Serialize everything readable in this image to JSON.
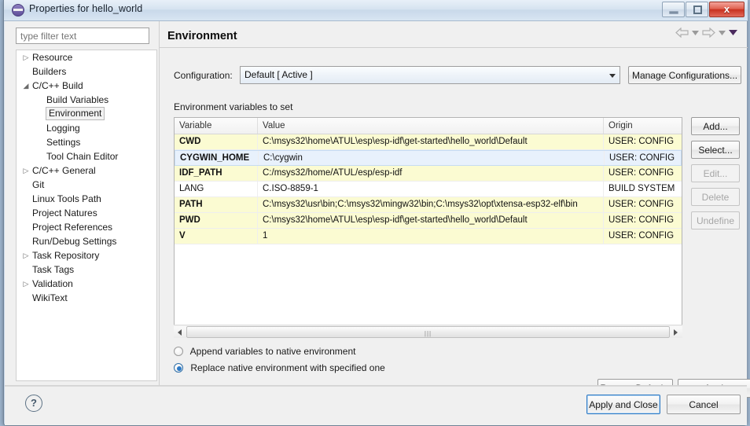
{
  "window": {
    "title": "Properties for hello_world",
    "icon": "eclipse-icon",
    "minimize_label": "",
    "restore_label": "",
    "close_label": "x"
  },
  "sidebar": {
    "filter_placeholder": "type filter text",
    "filter_value": "",
    "items": [
      {
        "label": "Resource",
        "indent": 0,
        "twisty": "collapsed",
        "selected": false
      },
      {
        "label": "Builders",
        "indent": 0,
        "twisty": "none",
        "selected": false
      },
      {
        "label": "C/C++ Build",
        "indent": 0,
        "twisty": "expanded",
        "selected": false
      },
      {
        "label": "Build Variables",
        "indent": 1,
        "twisty": "none",
        "selected": false
      },
      {
        "label": "Environment",
        "indent": 1,
        "twisty": "none",
        "selected": true
      },
      {
        "label": "Logging",
        "indent": 1,
        "twisty": "none",
        "selected": false
      },
      {
        "label": "Settings",
        "indent": 1,
        "twisty": "none",
        "selected": false
      },
      {
        "label": "Tool Chain Editor",
        "indent": 1,
        "twisty": "none",
        "selected": false
      },
      {
        "label": "C/C++ General",
        "indent": 0,
        "twisty": "collapsed",
        "selected": false
      },
      {
        "label": "Git",
        "indent": 0,
        "twisty": "none",
        "selected": false
      },
      {
        "label": "Linux Tools Path",
        "indent": 0,
        "twisty": "none",
        "selected": false
      },
      {
        "label": "Project Natures",
        "indent": 0,
        "twisty": "none",
        "selected": false
      },
      {
        "label": "Project References",
        "indent": 0,
        "twisty": "none",
        "selected": false
      },
      {
        "label": "Run/Debug Settings",
        "indent": 0,
        "twisty": "none",
        "selected": false
      },
      {
        "label": "Task Repository",
        "indent": 0,
        "twisty": "collapsed",
        "selected": false
      },
      {
        "label": "Task Tags",
        "indent": 0,
        "twisty": "none",
        "selected": false
      },
      {
        "label": "Validation",
        "indent": 0,
        "twisty": "collapsed",
        "selected": false
      },
      {
        "label": "WikiText",
        "indent": 0,
        "twisty": "none",
        "selected": false
      }
    ]
  },
  "page": {
    "title": "Environment",
    "nav": {
      "back_icon": "back-arrow-icon",
      "back_menu_icon": "chevron-down-icon",
      "forward_icon": "forward-arrow-icon",
      "forward_menu_icon": "chevron-down-icon",
      "view_menu_icon": "view-menu-triangle-icon"
    },
    "configuration": {
      "label": "Configuration:",
      "selected": "Default  [ Active ]",
      "dropdown_icon": "chevron-down-icon",
      "manage_label": "Manage Configurations..."
    },
    "table_label": "Environment variables to set",
    "table": {
      "columns": [
        "Variable",
        "Value",
        "Origin"
      ],
      "rows": [
        {
          "variable": "CWD",
          "value": "C:\\msys32\\home\\ATUL\\esp\\esp-idf\\get-started\\hello_world\\Default",
          "origin": "USER: CONFIG",
          "user_set": true,
          "selected": false
        },
        {
          "variable": "CYGWIN_HOME",
          "value": "C:\\cygwin",
          "origin": "USER: CONFIG",
          "user_set": true,
          "selected": true
        },
        {
          "variable": "IDF_PATH",
          "value": "C:/msys32/home/ATUL/esp/esp-idf",
          "origin": "USER: CONFIG",
          "user_set": true,
          "selected": false
        },
        {
          "variable": "LANG",
          "value": "C.ISO-8859-1",
          "origin": "BUILD SYSTEM",
          "user_set": false,
          "selected": false
        },
        {
          "variable": "PATH",
          "value": "C:\\msys32\\usr\\bin;C:\\msys32\\mingw32\\bin;C:\\msys32\\opt\\xtensa-esp32-elf\\bin",
          "origin": "USER: CONFIG",
          "user_set": true,
          "selected": false
        },
        {
          "variable": "PWD",
          "value": "C:\\msys32\\home\\ATUL\\esp\\esp-idf\\get-started\\hello_world\\Default",
          "origin": "USER: CONFIG",
          "user_set": true,
          "selected": false
        },
        {
          "variable": "V",
          "value": "1",
          "origin": "USER: CONFIG",
          "user_set": true,
          "selected": false
        }
      ]
    },
    "scrollbar": {
      "left_arrow_icon": "scroll-left-icon",
      "right_arrow_icon": "scroll-right-icon",
      "grip": "|||"
    },
    "side_buttons": [
      {
        "label": "Add...",
        "enabled": true
      },
      {
        "label": "Select...",
        "enabled": true
      },
      {
        "label": "Edit...",
        "enabled": false
      },
      {
        "label": "Delete",
        "enabled": false
      },
      {
        "label": "Undefine",
        "enabled": false
      }
    ],
    "radios": [
      {
        "label": "Append variables to native environment",
        "checked": false
      },
      {
        "label": "Replace native environment with specified one",
        "checked": true
      }
    ],
    "restore_defaults_label": "Restore Defaults",
    "apply_label": "Apply"
  },
  "footer": {
    "help_icon": "help-question-icon",
    "help_glyph": "?",
    "apply_and_close_label": "Apply and Close",
    "cancel_label": "Cancel"
  },
  "colors": {
    "user_row": "#fbfbd2",
    "selected_row": "#e8f1fc",
    "build_row": "#ffffff",
    "default_button_border": "#2c78c4",
    "close_button": "#c8311f"
  }
}
